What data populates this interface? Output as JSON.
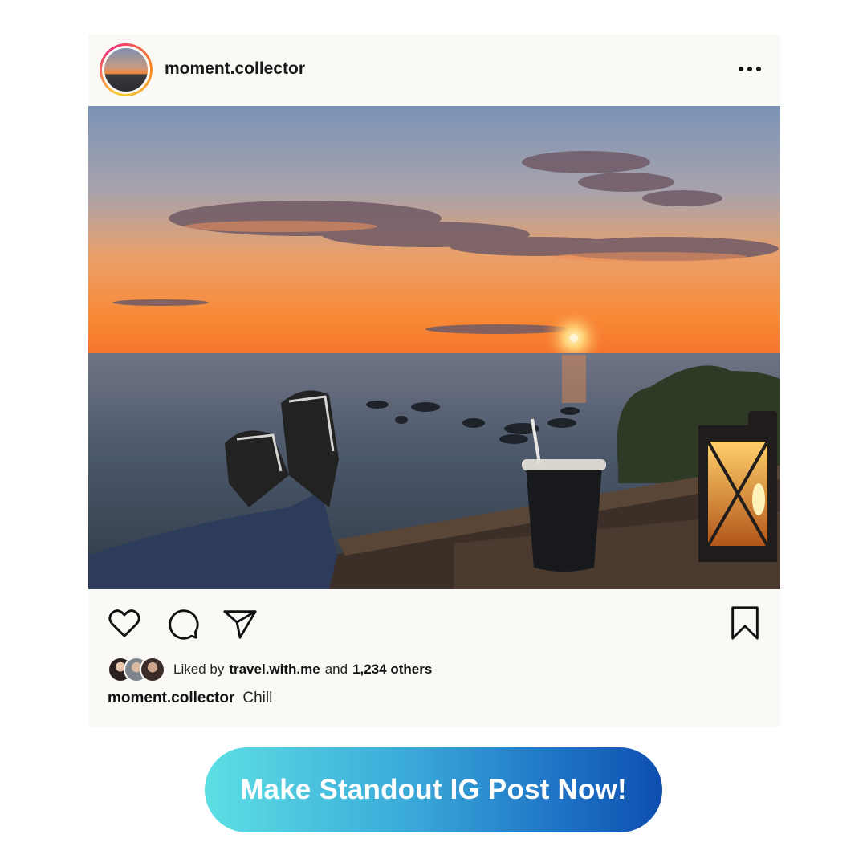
{
  "post": {
    "username": "moment.collector",
    "liked_by_prefix": "Liked by",
    "liked_by_user": "travel.with.me",
    "liked_by_and": "and",
    "liked_by_others": "1,234 others",
    "caption_user": "moment.collector",
    "caption_text": "Chill"
  },
  "icons": {
    "more": "more-horizontal-icon",
    "like": "heart-icon",
    "comment": "comment-bubble-icon",
    "share": "paper-plane-icon",
    "save": "bookmark-icon"
  },
  "cta": {
    "label": "Make Standout IG Post Now!"
  },
  "colors": {
    "card_bg": "#faf9f6",
    "cta_gradient_start": "#5ddfe4",
    "cta_gradient_end": "#0e4fae",
    "avatar_ring": "#ee2a7b"
  }
}
